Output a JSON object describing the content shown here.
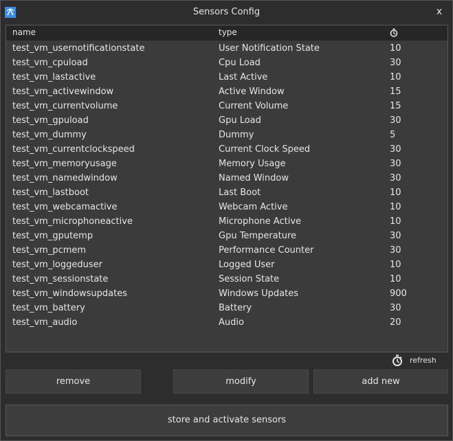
{
  "window": {
    "title": "Sensors Config",
    "close_label": "x"
  },
  "table": {
    "columns": {
      "name": "name",
      "type": "type"
    },
    "rows": [
      {
        "name": "test_vm_usernotificationstate",
        "type": "User Notification State",
        "interval": "10"
      },
      {
        "name": "test_vm_cpuload",
        "type": "Cpu Load",
        "interval": "30"
      },
      {
        "name": "test_vm_lastactive",
        "type": "Last Active",
        "interval": "10"
      },
      {
        "name": "test_vm_activewindow",
        "type": "Active Window",
        "interval": "15"
      },
      {
        "name": "test_vm_currentvolume",
        "type": "Current Volume",
        "interval": "15"
      },
      {
        "name": "test_vm_gpuload",
        "type": "Gpu Load",
        "interval": "30"
      },
      {
        "name": "test_vm_dummy",
        "type": "Dummy",
        "interval": "5"
      },
      {
        "name": "test_vm_currentclockspeed",
        "type": "Current Clock Speed",
        "interval": "30"
      },
      {
        "name": "test_vm_memoryusage",
        "type": "Memory Usage",
        "interval": "30"
      },
      {
        "name": "test_vm_namedwindow",
        "type": "Named Window",
        "interval": "30"
      },
      {
        "name": "test_vm_lastboot",
        "type": "Last Boot",
        "interval": "10"
      },
      {
        "name": "test_vm_webcamactive",
        "type": "Webcam Active",
        "interval": "10"
      },
      {
        "name": "test_vm_microphoneactive",
        "type": "Microphone Active",
        "interval": "10"
      },
      {
        "name": "test_vm_gputemp",
        "type": "Gpu Temperature",
        "interval": "30"
      },
      {
        "name": "test_vm_pcmem",
        "type": "Performance Counter",
        "interval": "30"
      },
      {
        "name": "test_vm_loggeduser",
        "type": "Logged User",
        "interval": "10"
      },
      {
        "name": "test_vm_sessionstate",
        "type": "Session State",
        "interval": "10"
      },
      {
        "name": "test_vm_windowsupdates",
        "type": "Windows Updates",
        "interval": "900"
      },
      {
        "name": "test_vm_battery",
        "type": "Battery",
        "interval": "30"
      },
      {
        "name": "test_vm_audio",
        "type": "Audio",
        "interval": "20"
      }
    ]
  },
  "icons": {
    "app": "sensor-app-icon",
    "interval_header": "stopwatch-icon",
    "refresh": "stopwatch-icon"
  },
  "refresh_label": "refresh",
  "buttons": {
    "remove": "remove",
    "modify": "modify",
    "add_new": "add new",
    "store": "store and activate sensors"
  },
  "colors": {
    "background": "#2d2d2d",
    "table_background": "#3b3b3b",
    "header_background": "#262626",
    "button_background": "#3d3d3d",
    "accent": "#3a8ee6",
    "text": "#e6e6e6"
  }
}
